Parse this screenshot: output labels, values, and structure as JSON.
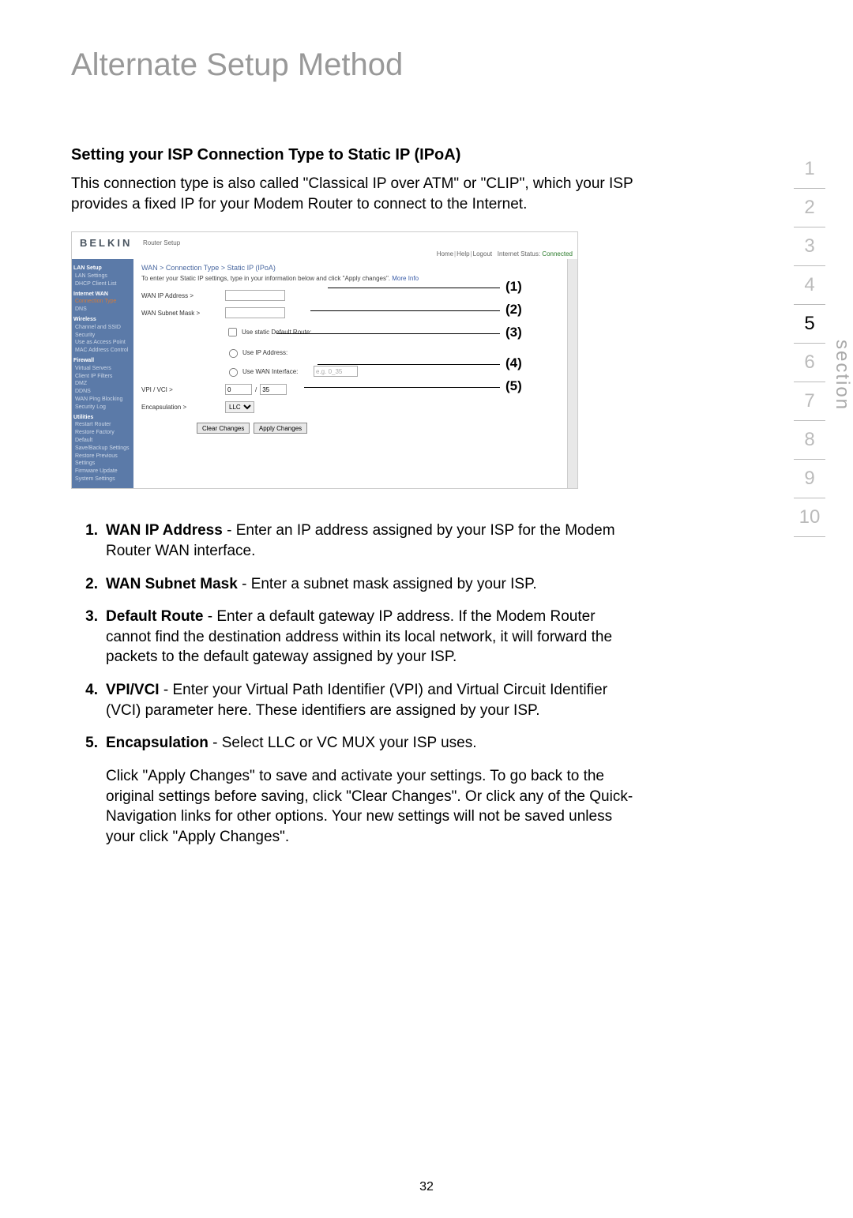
{
  "page": {
    "title": "Alternate Setup Method",
    "subtitle": "Setting your ISP Connection Type to Static IP (IPoA)",
    "intro": "This connection type is also called \"Classical IP over ATM\" or \"CLIP\", which your ISP provides a fixed IP for your Modem Router to connect to the Internet.",
    "page_number": "32"
  },
  "section_nav": {
    "label": "section",
    "items": [
      "1",
      "2",
      "3",
      "4",
      "5",
      "6",
      "7",
      "8",
      "9",
      "10"
    ],
    "active": "5"
  },
  "router": {
    "logo": "BELKIN",
    "top_label": "Router Setup",
    "top_links": {
      "home": "Home",
      "help": "Help",
      "logout": "Logout",
      "status_label": "Internet Status:",
      "status_value": "Connected"
    },
    "sidebar": {
      "lan_setup": "LAN Setup",
      "lan_settings": "LAN Settings",
      "dhcp": "DHCP Client List",
      "internet_wan": "Internet WAN",
      "conn_type": "Connection Type",
      "dns": "DNS",
      "wireless": "Wireless",
      "channel": "Channel and SSID",
      "security": "Security",
      "ap": "Use as Access Point",
      "mac": "MAC Address Control",
      "firewall": "Firewall",
      "virtual": "Virtual Servers",
      "client": "Client IP Filters",
      "dmz": "DMZ",
      "ddns": "DDNS",
      "wanping": "WAN Ping Blocking",
      "seclog": "Security Log",
      "utilities": "Utilities",
      "restart": "Restart Router",
      "factory": "Restore Factory Default",
      "backup": "Save/Backup Settings",
      "restore": "Restore Previous Settings",
      "firmware": "Firmware Update",
      "system": "System Settings"
    },
    "breadcrumb": "WAN > Connection Type > Static IP (IPoA)",
    "instruction_pre": "To enter your Static IP settings, type in your information below and click \"Apply changes\". ",
    "instruction_link": "More Info",
    "fields": {
      "wan_ip": "WAN IP Address >",
      "subnet": "WAN Subnet Mask >",
      "default_route_cb": "Use static Default Route:",
      "use_ip": "Use IP Address:",
      "use_wan_if": "Use WAN Interface:",
      "wan_if_value": "e.g. 0_35",
      "vpi_vci": "VPI / VCI >",
      "vpi_value": "0",
      "vci_value": "35",
      "slash": "/",
      "encap": "Encapsulation >",
      "encap_value": "LLC"
    },
    "buttons": {
      "clear": "Clear Changes",
      "apply": "Apply Changes"
    }
  },
  "callouts": {
    "c1": "(1)",
    "c2": "(2)",
    "c3": "(3)",
    "c4": "(4)",
    "c5": "(5)"
  },
  "list": {
    "i1": {
      "n": "1.",
      "b": "WAN IP Address",
      "t": " - Enter an IP address assigned by your ISP for the Modem Router WAN interface."
    },
    "i2": {
      "n": "2.",
      "b": "WAN Subnet Mask",
      "t": " - Enter a subnet mask assigned by your ISP."
    },
    "i3": {
      "n": "3.",
      "b": "Default Route",
      "t": " - Enter a default gateway IP address. If the Modem Router cannot find the destination address within its local network, it will forward the packets to the default gateway assigned by your ISP."
    },
    "i4": {
      "n": "4.",
      "b": "VPI/VCI",
      "t": " - Enter your Virtual Path Identifier (VPI) and Virtual Circuit Identifier (VCI) parameter here. These identifiers are assigned by your ISP."
    },
    "i5": {
      "n": "5.",
      "b": "Encapsulation",
      "t": " - Select LLC or VC MUX your ISP uses."
    },
    "extra": "Click \"Apply Changes\" to save and activate your settings. To go back to the original settings before saving, click \"Clear Changes\". Or click any of the Quick-Navigation links for other options. Your new settings will not be saved unless your click \"Apply Changes\"."
  }
}
